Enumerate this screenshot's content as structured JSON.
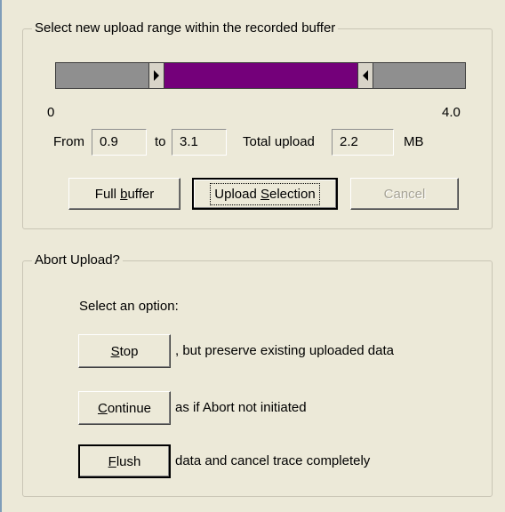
{
  "range_group": {
    "title": "Select new upload range within the recorded buffer",
    "slider": {
      "min_label": "0",
      "max_label": "4.0",
      "min_value": 0,
      "max_value": 4.0,
      "selection_start": 0.9,
      "selection_end": 3.1,
      "selection_color": "#74007a",
      "track_color": "#8f8f8f"
    },
    "from_label": "From",
    "from_value": "0.9",
    "to_label": "to",
    "to_value": "3.1",
    "total_label": "Total upload",
    "total_value": "2.2",
    "unit_label": "MB",
    "buttons": {
      "full_buffer": {
        "pre": "Full ",
        "mnemonic": "b",
        "post": "uffer"
      },
      "upload_selection": {
        "pre": "Upload ",
        "mnemonic": "S",
        "post": "election"
      },
      "cancel": "Cancel"
    }
  },
  "abort_group": {
    "title": "Abort Upload?",
    "prompt": "Select an option:",
    "options": [
      {
        "mnemonic": "S",
        "post": "top",
        "description": ", but preserve existing uploaded data"
      },
      {
        "mnemonic": "C",
        "post": "ontinue",
        "description": "as if Abort not initiated"
      },
      {
        "mnemonic": "F",
        "post": "lush",
        "description": "data and cancel trace completely"
      }
    ]
  }
}
